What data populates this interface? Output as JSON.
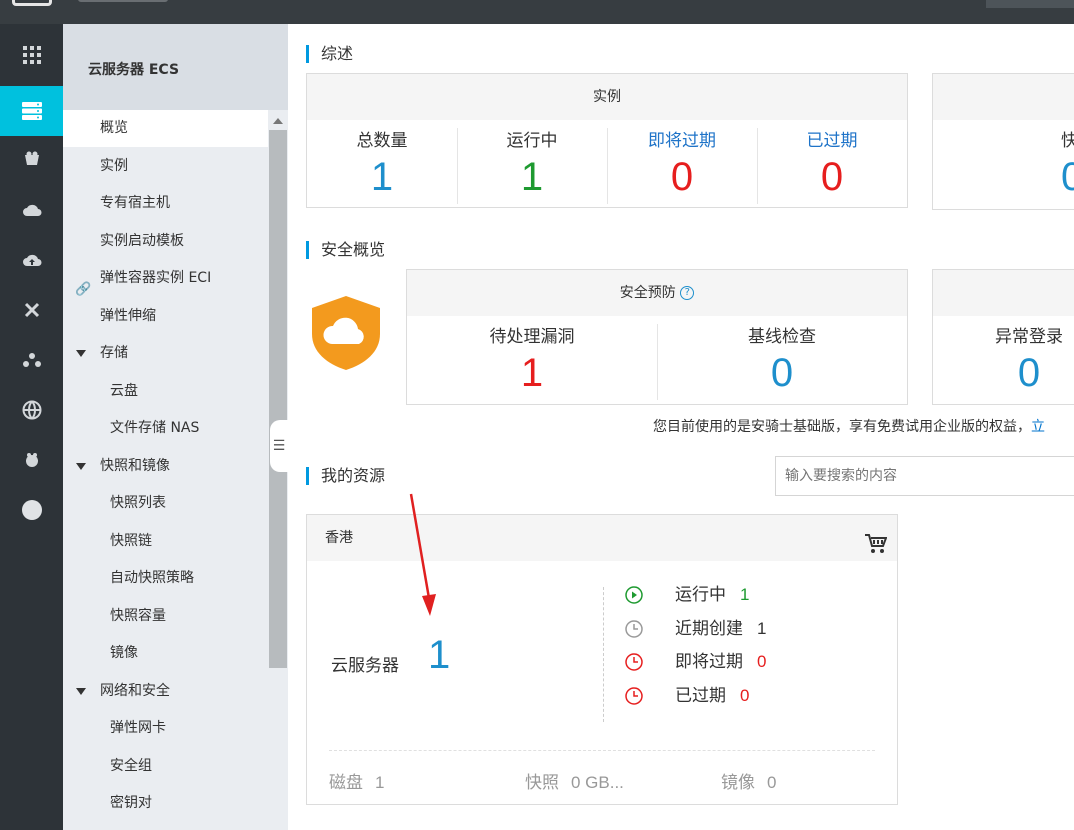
{
  "colors": {
    "accent": "#00c1de",
    "blue": "#1e8fcc",
    "green": "#1e9a30",
    "red": "#e61e1e",
    "link": "#0073cc"
  },
  "rail": {
    "icons": [
      "apps-grid-icon",
      "server-icon",
      "gift-box-icon",
      "cloud-icon",
      "cloud-upload-icon",
      "network-x-icon",
      "cluster-icon",
      "globe-icon",
      "bug-icon",
      "circle-icon"
    ]
  },
  "subnav": {
    "title": "云服务器 ECS",
    "items": [
      {
        "label": "概览"
      },
      {
        "label": "实例"
      },
      {
        "label": "专有宿主机"
      },
      {
        "label": "实例启动模板"
      },
      {
        "label": "弹性容器实例 ECI"
      },
      {
        "label": "弹性伸缩"
      },
      {
        "label": "存储"
      },
      {
        "label": "云盘"
      },
      {
        "label": "文件存储 NAS"
      },
      {
        "label": "快照和镜像"
      },
      {
        "label": "快照列表"
      },
      {
        "label": "快照链"
      },
      {
        "label": "自动快照策略"
      },
      {
        "label": "快照容量"
      },
      {
        "label": "镜像"
      },
      {
        "label": "网络和安全"
      },
      {
        "label": "弹性网卡"
      },
      {
        "label": "安全组"
      },
      {
        "label": "密钥对"
      }
    ]
  },
  "overview": {
    "title": "综述",
    "instances": {
      "head": "实例",
      "stats": [
        {
          "label": "总数量",
          "value": "1"
        },
        {
          "label": "运行中",
          "value": "1"
        },
        {
          "label": "即将过期",
          "value": "0"
        },
        {
          "label": "已过期",
          "value": "0"
        }
      ]
    },
    "partial_card": {
      "label": "快",
      "value": "0"
    }
  },
  "security": {
    "title": "安全概览",
    "card_head": "安全预防",
    "stats": [
      {
        "label": "待处理漏洞",
        "value": "1"
      },
      {
        "label": "基线检查",
        "value": "0"
      }
    ],
    "partial_card": {
      "label": "异常登录",
      "value": "0"
    },
    "notice": "您目前使用的是安骑士基础版，享有免费试用企业版的权益，",
    "notice_link": "立"
  },
  "resources": {
    "title": "我的资源",
    "search_placeholder": "输入要搜索的内容",
    "region": "香港",
    "ecs_label": "云服务器",
    "ecs_count": "1",
    "statuses": [
      {
        "label": "运行中",
        "value": "1"
      },
      {
        "label": "近期创建",
        "value": "1"
      },
      {
        "label": "即将过期",
        "value": "0"
      },
      {
        "label": "已过期",
        "value": "0"
      }
    ],
    "footer": [
      {
        "label": "磁盘",
        "value": "1"
      },
      {
        "label": "快照",
        "value": "0 GB..."
      },
      {
        "label": "镜像",
        "value": "0"
      }
    ]
  }
}
